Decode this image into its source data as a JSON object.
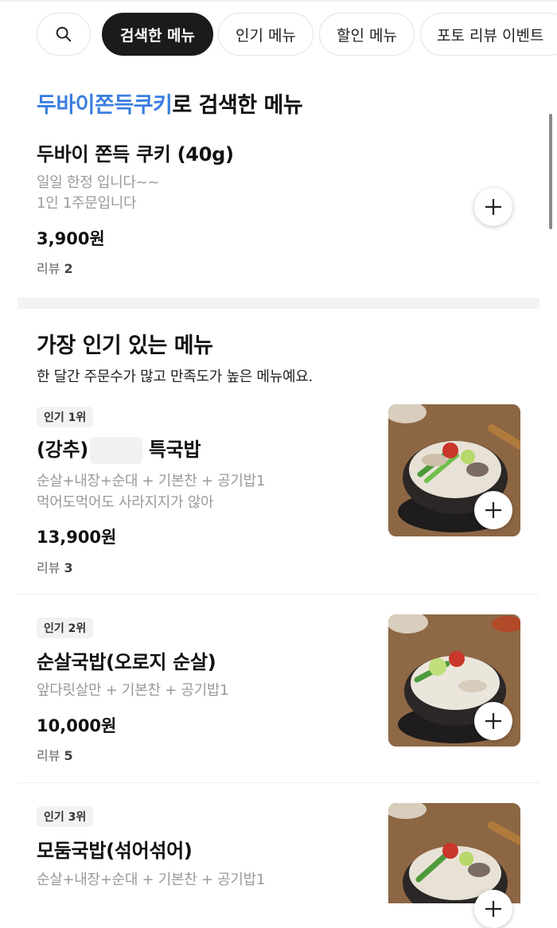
{
  "chips": {
    "search_icon": "search-icon",
    "items": [
      "검색한 메뉴",
      "인기 메뉴",
      "할인 메뉴",
      "포토 리뷰 이벤트"
    ]
  },
  "search_section": {
    "keyword": "두바이쫀득쿠키",
    "title_suffix": "로 검색한 메뉴",
    "item": {
      "name": "두바이 쫀득 쿠키 (40g)",
      "desc_line1": "일일 한정 입니다~~",
      "desc_line2": "1인 1주문입니다",
      "price": "3,900원",
      "review_label": "리뷰",
      "review_count": "2"
    }
  },
  "popular_section": {
    "title": "가장 인기 있는 메뉴",
    "subtitle": "한 달간 주문수가 많고 만족도가 높은 메뉴예요.",
    "items": [
      {
        "rank": "인기 1위",
        "name_prefix": "(강추)",
        "name_suffix": "특국밥",
        "desc_line1": "순살+내장+순대 + 기본찬 + 공기밥1",
        "desc_line2": "먹어도먹어도 사라지지가 않아",
        "price": "13,900원",
        "review_label": "리뷰",
        "review_count": "3"
      },
      {
        "rank": "인기 2위",
        "name": "순살국밥(오로지 순살)",
        "desc_line1": "앞다릿살만 + 기본찬 + 공기밥1",
        "price": "10,000원",
        "review_label": "리뷰",
        "review_count": "5"
      },
      {
        "rank": "인기 3위",
        "name": "모둠국밥(섞어섞어)",
        "desc_line1": "순살+내장+순대 + 기본찬 + 공기밥1"
      }
    ]
  },
  "colors": {
    "keyword_blue": "#3a7ee0",
    "active_chip_bg": "#1b1b1b",
    "desc_gray": "#9a9a9a"
  }
}
